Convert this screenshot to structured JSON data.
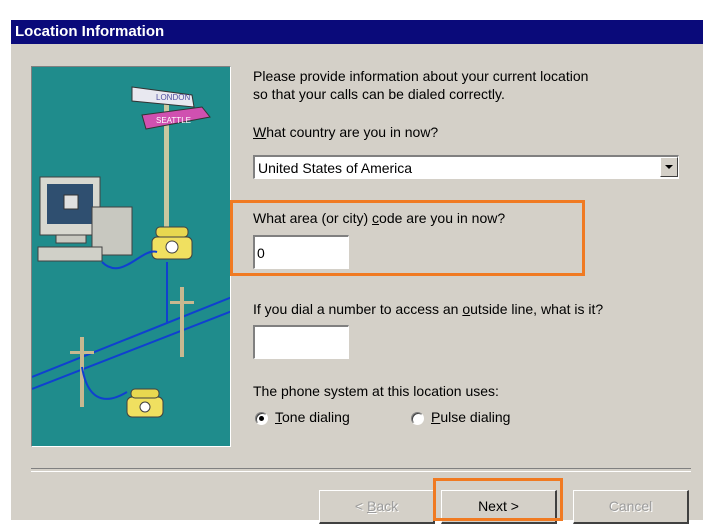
{
  "window": {
    "title": "Location Information"
  },
  "intro": {
    "line1": "Please provide information about your current location",
    "line2": "so that your calls can be dialed correctly."
  },
  "country": {
    "label_key": "W",
    "label_rest": "hat country are you in now?",
    "value": "United States of America"
  },
  "area_code": {
    "label_pre": "What area (or city) ",
    "label_key": "c",
    "label_rest": "ode are you in now?",
    "value": "0"
  },
  "outside_line": {
    "label_pre": "If you dial a number to access an ",
    "label_key": "o",
    "label_rest": "utside line, what is it?",
    "value": ""
  },
  "phone_system": {
    "label": "The phone system at this location uses:",
    "tone_key": "T",
    "tone_rest": "one dialing",
    "pulse_key": "P",
    "pulse_rest": "ulse dialing",
    "selected": "tone"
  },
  "illustration": {
    "sign_top": "LONDON",
    "sign_bottom": "SEATTLE"
  },
  "buttons": {
    "back_pre": "< ",
    "back_key": "B",
    "back_rest": "ack",
    "next": "Next >",
    "cancel": "Cancel"
  },
  "colors": {
    "titlebar": "#0a0a7a",
    "dialog": "#d4d0c8",
    "illustration_bg": "#1f8c8c",
    "highlight": "#f07a22"
  }
}
